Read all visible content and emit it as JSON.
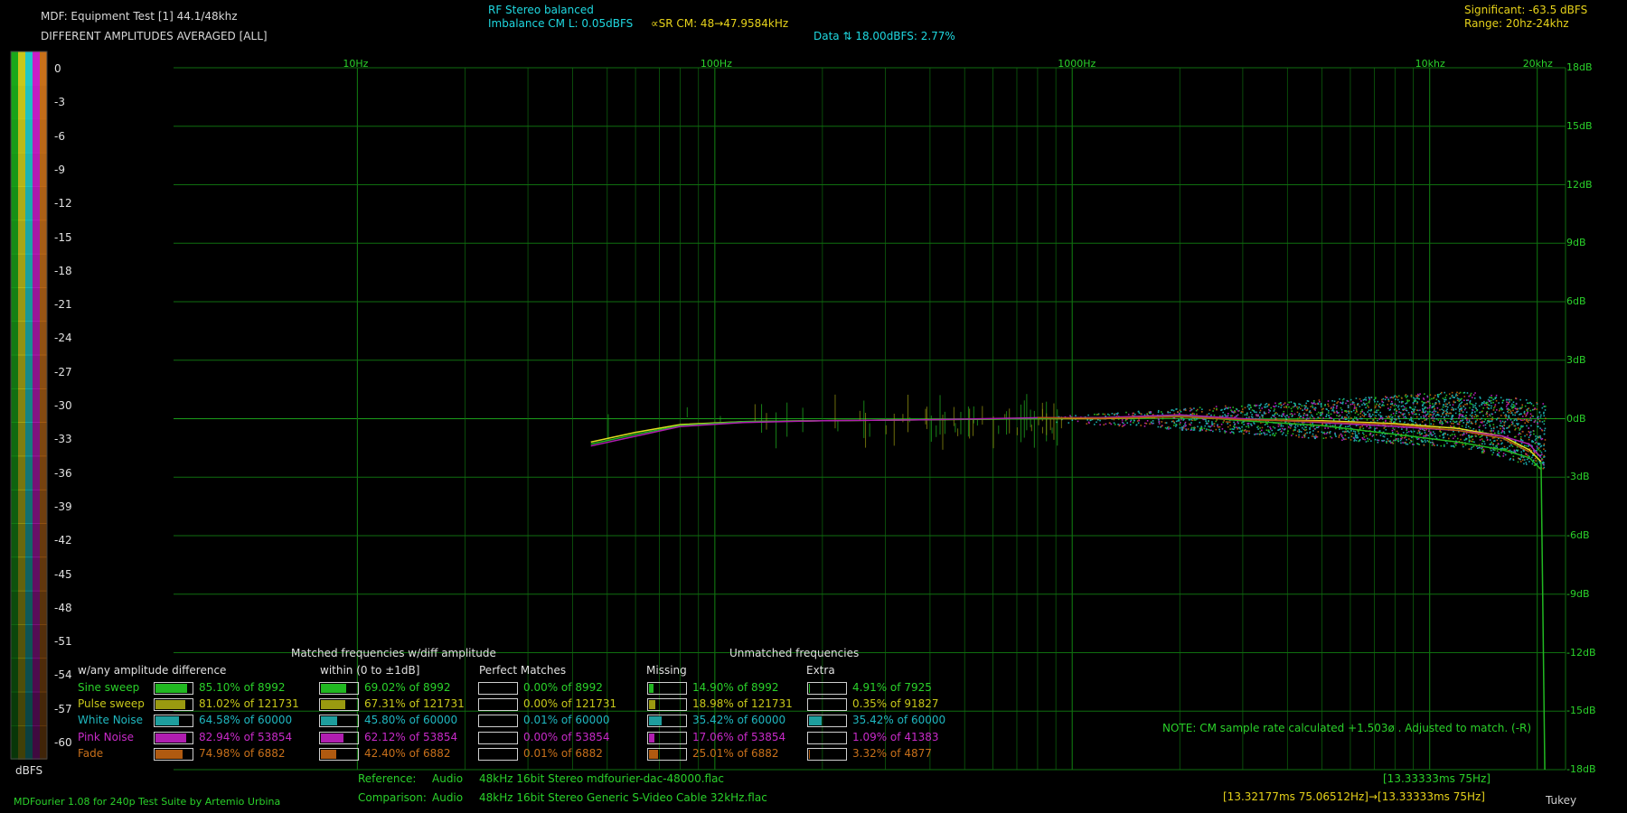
{
  "header": {
    "title": "MDF: Equipment Test [1] 44.1/48khz",
    "subtitle": "DIFFERENT AMPLITUDES AVERAGED [ALL]",
    "rf_stereo": "RF Stereo balanced",
    "imbalance": "Imbalance CM L: 0.05dBFS",
    "sr_cm": "∝SR CM: 48→47.9584kHz",
    "data_note": "Data ⇅ 18.00dBFS: 2.77%",
    "significant": "Significant: -63.5 dBFS",
    "range": "Range: 20hz-24khz"
  },
  "colors": {
    "grid": "#0f6e0f",
    "zero_line": "#1b9c1b",
    "sine": "#21b821",
    "pulse": "#9a9a10",
    "white_noise": "#1e9e9e",
    "pink_noise": "#b01eb0",
    "fade": "#b05a10",
    "scatter_teal": "#1aa8a8"
  },
  "scale_bar": {
    "labels": [
      "0",
      "-3",
      "-6",
      "-9",
      "-12",
      "-15",
      "-18",
      "-21",
      "-24",
      "-27",
      "-30",
      "-33",
      "-36",
      "-39",
      "-42",
      "-45",
      "-48",
      "-51",
      "-54",
      "-57",
      "-60"
    ],
    "unit": "dBFS"
  },
  "chart_data": {
    "type": "scatter",
    "x_scale": "log",
    "xlim": [
      1,
      24000
    ],
    "ylim": [
      -18,
      18
    ],
    "x_tick_labels": [
      {
        "x": 10,
        "label": "10Hz"
      },
      {
        "x": 100,
        "label": "100Hz"
      },
      {
        "x": 1000,
        "label": "1000Hz"
      },
      {
        "x": 10000,
        "label": "10khz"
      },
      {
        "x": 20000,
        "label": "20khz"
      }
    ],
    "y_ticks": [
      18,
      15,
      12,
      9,
      6,
      3,
      0,
      -3,
      -6,
      -9,
      -12,
      -15,
      -18
    ],
    "y_tick_labels": [
      "18dB",
      "15dB",
      "12dB",
      "9dB",
      "6dB",
      "3dB",
      "0dB",
      "-3dB",
      "-6dB",
      "-9dB",
      "-12dB",
      "-15dB",
      "-18dB"
    ],
    "series": [
      {
        "color_key": "pulse",
        "points": [
          [
            45,
            -1.2
          ],
          [
            60,
            -0.7
          ],
          [
            80,
            -0.3
          ],
          [
            120,
            -0.15
          ],
          [
            200,
            -0.1
          ],
          [
            400,
            -0.05
          ],
          [
            800,
            0.0
          ],
          [
            1200,
            0.0
          ],
          [
            2000,
            0.1
          ],
          [
            3000,
            -0.05
          ],
          [
            5000,
            -0.1
          ],
          [
            8000,
            -0.25
          ],
          [
            12000,
            -0.5
          ],
          [
            16000,
            -0.9
          ],
          [
            19000,
            -1.6
          ],
          [
            20500,
            -2.2
          ]
        ]
      },
      {
        "color_key": "sine",
        "points": [
          [
            45,
            -1.3
          ],
          [
            60,
            -0.8
          ],
          [
            80,
            -0.35
          ],
          [
            120,
            -0.15
          ],
          [
            200,
            -0.1
          ],
          [
            400,
            -0.05
          ],
          [
            800,
            0.0
          ],
          [
            1200,
            0.05
          ],
          [
            2000,
            0.15
          ],
          [
            3000,
            -0.1
          ],
          [
            5000,
            -0.35
          ],
          [
            8000,
            -0.8
          ],
          [
            12000,
            -1.2
          ],
          [
            16000,
            -1.6
          ],
          [
            19000,
            -2.0
          ],
          [
            20500,
            -2.6
          ]
        ]
      },
      {
        "color_key": "pink_noise",
        "points": [
          [
            45,
            -1.4
          ],
          [
            60,
            -0.9
          ],
          [
            80,
            -0.4
          ],
          [
            120,
            -0.2
          ],
          [
            200,
            -0.1
          ],
          [
            400,
            -0.05
          ],
          [
            800,
            0.05
          ],
          [
            1200,
            0.05
          ],
          [
            2000,
            0.2
          ],
          [
            3000,
            0.0
          ],
          [
            5000,
            -0.2
          ],
          [
            8000,
            -0.4
          ],
          [
            12000,
            -0.6
          ],
          [
            16000,
            -0.9
          ],
          [
            19000,
            -1.3
          ],
          [
            20500,
            -2.0
          ]
        ]
      },
      {
        "color_key": "fade",
        "points": [
          [
            800,
            0.05
          ],
          [
            1200,
            0.02
          ],
          [
            2000,
            0.1
          ],
          [
            3000,
            -0.05
          ],
          [
            5000,
            -0.15
          ],
          [
            8000,
            -0.3
          ],
          [
            12000,
            -0.6
          ],
          [
            16000,
            -1.0
          ],
          [
            19000,
            -1.7
          ]
        ]
      }
    ],
    "noise_cloud_range": [
      900,
      21000
    ],
    "dropoff_hz": 21000,
    "dropoff_db": -18
  },
  "legend": {
    "group_matched": "Matched frequencies w/diff amplitude",
    "group_unmatched": "Unmatched frequencies",
    "columns": [
      "w/any amplitude difference",
      "within (0 to ±1dB]",
      "Perfect Matches",
      "Missing",
      "Extra"
    ],
    "rows": [
      {
        "name": "Sine sweep",
        "color_key": "sine",
        "text_color": "#2ad12a",
        "cells": [
          {
            "pct": 85.1,
            "text": "85.10% of 8992"
          },
          {
            "pct": 69.02,
            "text": "69.02% of 8992"
          },
          {
            "pct": 0.0,
            "text": "0.00% of 8992"
          },
          {
            "pct": 14.9,
            "text": "14.90% of 8992"
          },
          {
            "pct": 4.91,
            "text": "4.91% of 7925"
          }
        ]
      },
      {
        "name": "Pulse sweep",
        "color_key": "pulse",
        "text_color": "#c8c81a",
        "cells": [
          {
            "pct": 81.02,
            "text": "81.02% of 121731"
          },
          {
            "pct": 67.31,
            "text": "67.31% of 121731"
          },
          {
            "pct": 0.0,
            "text": "0.00% of 121731"
          },
          {
            "pct": 18.98,
            "text": "18.98% of 121731"
          },
          {
            "pct": 0.35,
            "text": "0.35% of 91827"
          }
        ]
      },
      {
        "name": "White Noise",
        "color_key": "white_noise",
        "text_color": "#1fb8c0",
        "cells": [
          {
            "pct": 64.58,
            "text": "64.58% of 60000"
          },
          {
            "pct": 45.8,
            "text": "45.80% of 60000"
          },
          {
            "pct": 0.01,
            "text": "0.01% of 60000"
          },
          {
            "pct": 35.42,
            "text": "35.42% of 60000"
          },
          {
            "pct": 35.42,
            "text": "35.42% of 60000"
          }
        ]
      },
      {
        "name": "Pink Noise",
        "color_key": "pink_noise",
        "text_color": "#c82ac8",
        "cells": [
          {
            "pct": 82.94,
            "text": "82.94% of 53854"
          },
          {
            "pct": 62.12,
            "text": "62.12% of 53854"
          },
          {
            "pct": 0.0,
            "text": "0.00% of 53854"
          },
          {
            "pct": 17.06,
            "text": "17.06% of 53854"
          },
          {
            "pct": 1.09,
            "text": "1.09% of 41383"
          }
        ]
      },
      {
        "name": "Fade",
        "color_key": "fade",
        "text_color": "#c8701a",
        "cells": [
          {
            "pct": 74.98,
            "text": "74.98% of 6882"
          },
          {
            "pct": 42.4,
            "text": "42.40% of 6882"
          },
          {
            "pct": 0.01,
            "text": "0.01% of 6882"
          },
          {
            "pct": 25.01,
            "text": "25.01% of 6882"
          },
          {
            "pct": 3.32,
            "text": "3.32% of 4877"
          }
        ]
      }
    ]
  },
  "note": "NOTE: CM sample rate calculated +1.503ø . Adjusted to match. (-R)",
  "footer": {
    "credits": "MDFourier 1.08 for 240p Test Suite by Artemio Urbina",
    "reference_label": "Reference:",
    "reference_kind": "Audio",
    "reference_file": "48kHz 16bit Stereo mdfourier-dac-48000.flac",
    "comparison_label": "Comparison:",
    "comparison_kind": "Audio",
    "comparison_file": "48kHz 16bit Stereo Generic S-Video Cable 32kHz.flac",
    "ref_timing": "[13.33333ms 75Hz]",
    "cmp_timing": "[13.32177ms 75.06512Hz]→[13.33333ms 75Hz]",
    "window": "Tukey"
  }
}
